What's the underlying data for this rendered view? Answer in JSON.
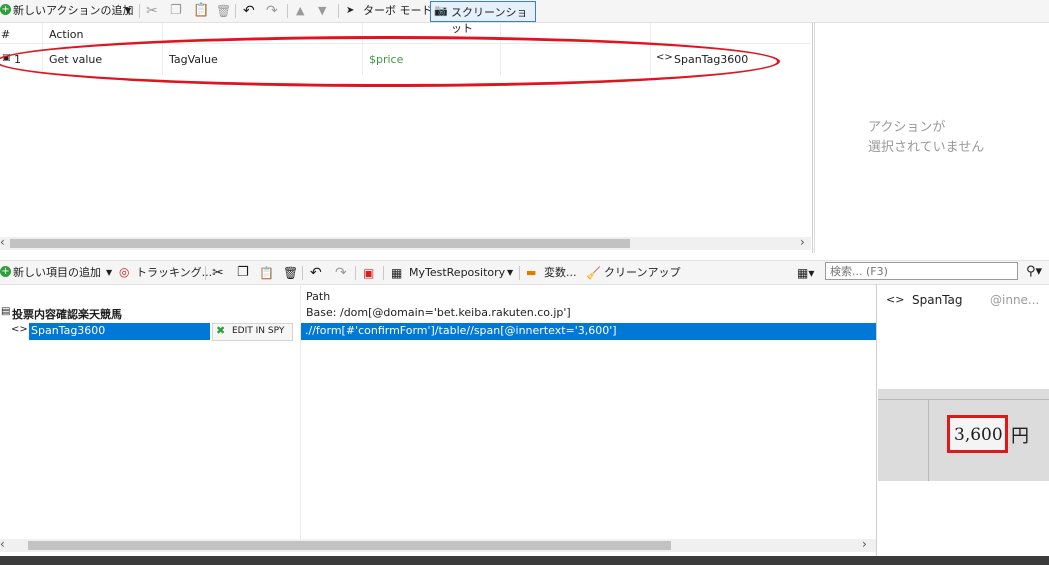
{
  "top_toolbar": {
    "add_action": "新しいアクションの追加",
    "turbo_mode": "ターボ モード",
    "screenshot": "スクリーンショット"
  },
  "actions_table": {
    "col_number": "#",
    "col_action": "Action",
    "row": {
      "number": "1",
      "action": "Get value",
      "attribute": "TagValue",
      "variable": "$price",
      "target": "SpanTag3600"
    }
  },
  "properties_panel": {
    "empty_line1": "アクションが",
    "empty_line2": "選択されていません"
  },
  "repo_toolbar": {
    "add_item": "新しい項目の追加",
    "tracking": "トラッキング...",
    "repository_name": "MyTestRepository",
    "variables": "変数...",
    "cleanup": "クリーンアップ",
    "search_placeholder": "検索... (F3)"
  },
  "repo_tree": {
    "path_header": "Path",
    "root_name": "投票内容確認楽天競馬",
    "root_path": "Base: /dom[@domain='bet.keiba.rakuten.co.jp']",
    "child_name": "SpanTag3600",
    "edit_in_spy": "EDIT IN SPY",
    "child_path": ".//form[#'confirmForm']/table//span[@innertext='3,600']"
  },
  "preview": {
    "title": "SpanTag",
    "subtitle": "@inne...",
    "price_text": "3,600",
    "yen": "円"
  },
  "colors": {
    "selection": "#0078d7",
    "variable_green": "#3c9a3c",
    "annotation_red": "#e0141e"
  }
}
